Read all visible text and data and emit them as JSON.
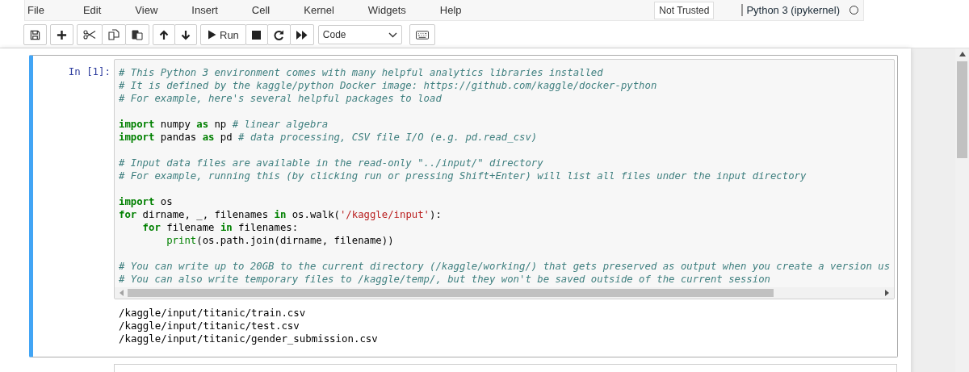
{
  "menu": [
    {
      "label": "File"
    },
    {
      "label": "Edit"
    },
    {
      "label": "View"
    },
    {
      "label": "Insert"
    },
    {
      "label": "Cell"
    },
    {
      "label": "Kernel"
    },
    {
      "label": "Widgets"
    },
    {
      "label": "Help"
    }
  ],
  "trust": {
    "label": "Not Trusted"
  },
  "kernel": {
    "label": "Python 3 (ipykernel)",
    "busy": false
  },
  "toolbar": {
    "groups": [
      [
        {
          "kind": "save"
        }
      ],
      [
        {
          "kind": "add"
        }
      ],
      [
        {
          "kind": "cut"
        },
        {
          "kind": "copy"
        },
        {
          "kind": "paste"
        }
      ],
      [
        {
          "kind": "up"
        },
        {
          "kind": "down"
        }
      ],
      [
        {
          "kind": "run",
          "label": "Run"
        },
        {
          "kind": "stop"
        },
        {
          "kind": "restart"
        },
        {
          "kind": "fastforward"
        }
      ]
    ],
    "cell_type": "Code"
  },
  "cell": {
    "prompt": "In [1]:",
    "selected": true,
    "lines": [
      {
        "kind": "code",
        "tokens": [
          {
            "kind": "comment",
            "s": "# This Python 3 environment comes with many helpful analytics libraries installed"
          }
        ]
      },
      {
        "kind": "code",
        "tokens": [
          {
            "kind": "comment",
            "s": "# It is defined by the kaggle/python Docker image: https://github.com/kaggle/docker-python"
          }
        ]
      },
      {
        "kind": "code",
        "tokens": [
          {
            "kind": "comment",
            "s": "# For example, here's several helpful packages to load"
          }
        ]
      },
      {
        "kind": "blank"
      },
      {
        "kind": "code",
        "tokens": [
          {
            "kind": "keyword",
            "s": "import"
          },
          {
            "kind": "plain",
            "s": " numpy "
          },
          {
            "kind": "keyword",
            "s": "as"
          },
          {
            "kind": "plain",
            "s": " np "
          },
          {
            "kind": "comment",
            "s": "# linear algebra"
          }
        ]
      },
      {
        "kind": "code",
        "tokens": [
          {
            "kind": "keyword",
            "s": "import"
          },
          {
            "kind": "plain",
            "s": " pandas "
          },
          {
            "kind": "keyword",
            "s": "as"
          },
          {
            "kind": "plain",
            "s": " pd "
          },
          {
            "kind": "comment",
            "s": "# data processing, CSV file I/O (e.g. pd.read_csv)"
          }
        ]
      },
      {
        "kind": "blank"
      },
      {
        "kind": "code",
        "tokens": [
          {
            "kind": "comment",
            "s": "# Input data files are available in the read-only \"../input/\" directory"
          }
        ]
      },
      {
        "kind": "code",
        "tokens": [
          {
            "kind": "comment",
            "s": "# For example, running this (by clicking run or pressing Shift+Enter) will list all files under the input directory"
          }
        ]
      },
      {
        "kind": "blank"
      },
      {
        "kind": "code",
        "tokens": [
          {
            "kind": "keyword",
            "s": "import"
          },
          {
            "kind": "plain",
            "s": " os"
          }
        ]
      },
      {
        "kind": "code",
        "tokens": [
          {
            "kind": "keyword",
            "s": "for"
          },
          {
            "kind": "plain",
            "s": " dirname, _, filenames "
          },
          {
            "kind": "keyword",
            "s": "in"
          },
          {
            "kind": "plain",
            "s": " os.walk("
          },
          {
            "kind": "string",
            "s": "'/kaggle/input'"
          },
          {
            "kind": "plain",
            "s": "):"
          }
        ],
        "children": [
          {
            "kind": "code",
            "tokens": [
              {
                "kind": "keyword",
                "s": "for"
              },
              {
                "kind": "plain",
                "s": " filename "
              },
              {
                "kind": "keyword",
                "s": "in"
              },
              {
                "kind": "plain",
                "s": " filenames:"
              }
            ],
            "children": [
              {
                "kind": "code",
                "tokens": [
                  {
                    "kind": "builtin",
                    "s": "print"
                  },
                  {
                    "kind": "plain",
                    "s": "(os.path.join(dirname, filename))"
                  }
                ]
              }
            ]
          }
        ]
      },
      {
        "kind": "blank"
      },
      {
        "kind": "code",
        "tokens": [
          {
            "kind": "comment",
            "s": "# You can write up to 20GB to the current directory (/kaggle/working/) that gets preserved as output when you create a version us"
          }
        ]
      },
      {
        "kind": "code",
        "tokens": [
          {
            "kind": "comment",
            "s": "# You can also write temporary files to /kaggle/temp/, but they won't be saved outside of the current session"
          }
        ]
      }
    ],
    "output": [
      "/kaggle/input/titanic/train.csv",
      "/kaggle/input/titanic/test.csv",
      "/kaggle/input/titanic/gender_submission.csv"
    ]
  }
}
